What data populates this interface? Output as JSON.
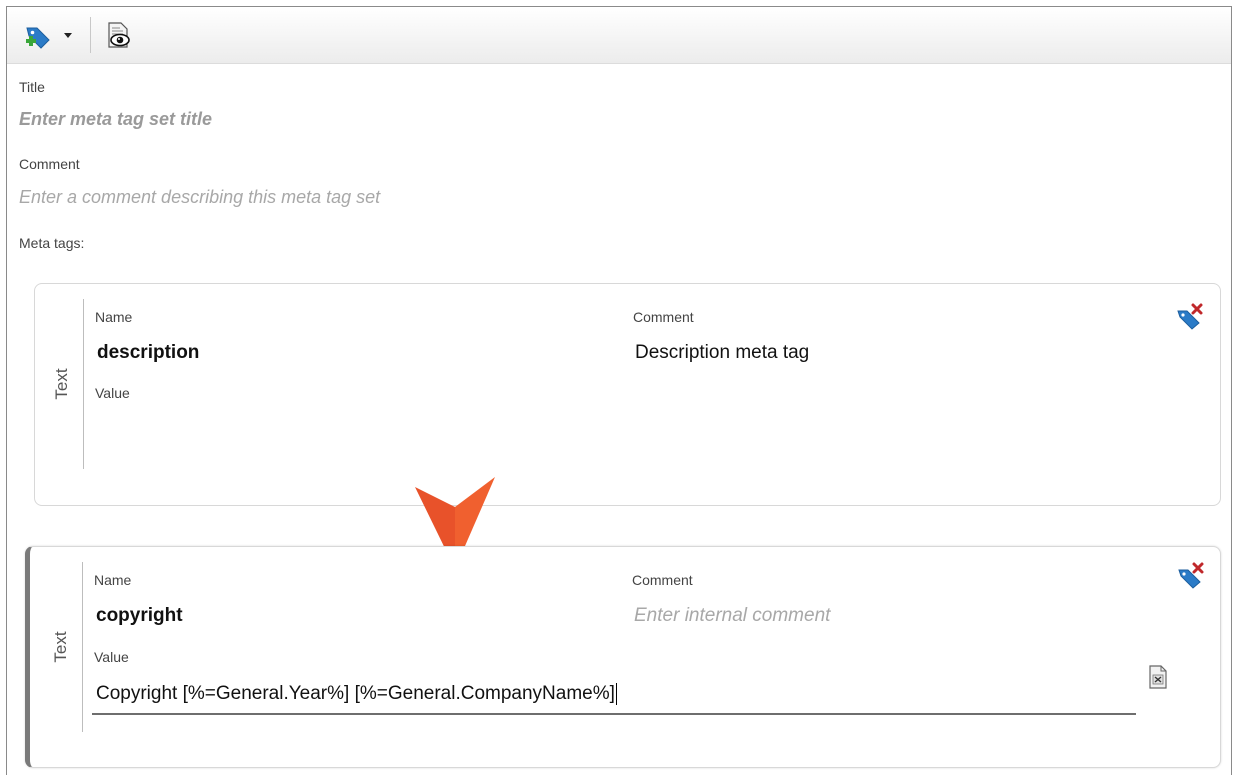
{
  "toolbar": {
    "add_icon": "tag-add-icon",
    "dropdown_icon": "caret-down-icon",
    "preview_icon": "document-eye-icon"
  },
  "form": {
    "title_label": "Title",
    "title_placeholder": "Enter meta tag set title",
    "comment_label": "Comment",
    "comment_placeholder": "Enter a comment describing this meta tag set",
    "meta_tags_label": "Meta tags:"
  },
  "meta_tags": [
    {
      "type": "Text",
      "name_label": "Name",
      "name": "description",
      "comment_label": "Comment",
      "comment": "Description meta tag",
      "value_label": "Value",
      "value": ""
    },
    {
      "type": "Text",
      "name_label": "Name",
      "name": "copyright",
      "comment_label": "Comment",
      "comment_placeholder": "Enter internal comment",
      "value_label": "Value",
      "value": "Copyright [%=General.Year%] [%=General.CompanyName%]"
    }
  ],
  "colors": {
    "accent_arrow": "#E8522A",
    "tag_blue": "#2B7BC7",
    "delete_red": "#C0282B"
  }
}
